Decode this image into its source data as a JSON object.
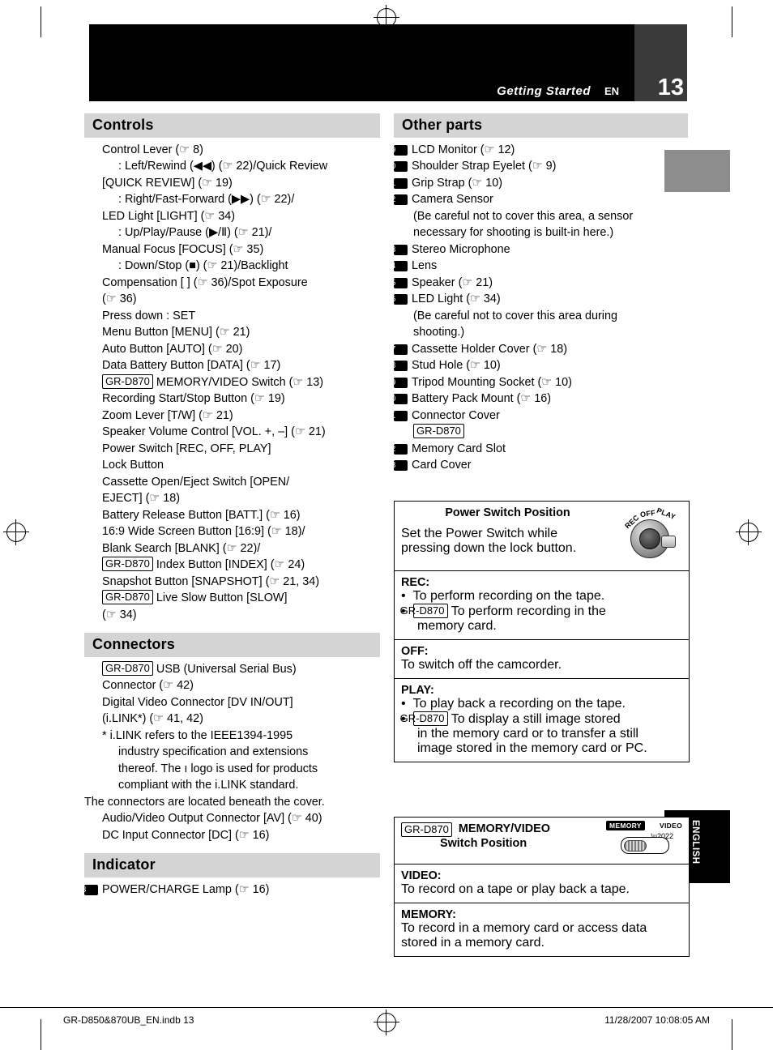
{
  "header": {
    "title": "Getting Started",
    "en": "EN",
    "page": "13"
  },
  "side_tab": {
    "label": "ENGLISH"
  },
  "footer": {
    "left": "GR-D850&870UB_EN.indb   13",
    "right": "11/28/2007   10:08:05 AM"
  },
  "left_column": {
    "controls": {
      "heading": "Controls",
      "lines": [
        {
          "indent": 1,
          "text": "Control Lever (☞ 8)"
        },
        {
          "indent": 2,
          "text": ": Left/Rewind (◀◀) (☞ 22)/Quick Review"
        },
        {
          "indent": 1,
          "text": "[QUICK REVIEW] (☞ 19)"
        },
        {
          "indent": 2,
          "text": ": Right/Fast-Forward (▶▶) (☞ 22)/"
        },
        {
          "indent": 1,
          "text": "LED Light [LIGHT] (☞ 34)"
        },
        {
          "indent": 2,
          "text": ": Up/Play/Pause (▶/Ⅱ) (☞ 21)/"
        },
        {
          "indent": 1,
          "text": "Manual Focus [FOCUS] (☞ 35)"
        },
        {
          "indent": 2,
          "text": ": Down/Stop (■) (☞ 21)/Backlight"
        },
        {
          "indent": 1,
          "text": "Compensation [    ] (☞ 36)/Spot Exposure"
        },
        {
          "indent": 1,
          "text": "(☞ 36)"
        },
        {
          "indent": 1,
          "text": "Press down : SET"
        },
        {
          "indent": 1,
          "text": "Menu Button [MENU] (☞ 21)"
        },
        {
          "indent": 1,
          "text": "Auto Button [AUTO] (☞ 20)"
        },
        {
          "indent": 1,
          "text": "Data Battery Button [DATA] (☞ 17)"
        },
        {
          "indent": 1,
          "badge": "GR-D870",
          "text": " MEMORY/VIDEO Switch (☞ 13)"
        },
        {
          "indent": 1,
          "text": "Recording Start/Stop Button (☞ 19)"
        },
        {
          "indent": 1,
          "text": "Zoom Lever [T/W] (☞ 21)"
        },
        {
          "indent": 1,
          "text": "Speaker Volume Control [VOL. +, –] (☞ 21)"
        },
        {
          "indent": 1,
          "text": "Power Switch [REC, OFF, PLAY]"
        },
        {
          "indent": 1,
          "text": "Lock Button"
        },
        {
          "indent": 1,
          "text": "Cassette Open/Eject Switch [OPEN/"
        },
        {
          "indent": 1,
          "text": "EJECT] (☞ 18)"
        },
        {
          "indent": 1,
          "text": "Battery Release Button [BATT.] (☞ 16)"
        },
        {
          "indent": 1,
          "text": "16:9 Wide Screen Button [16:9] (☞ 18)/"
        },
        {
          "indent": 1,
          "text": "Blank Search [BLANK] (☞ 22)/"
        },
        {
          "indent": 1,
          "badge": "GR-D870",
          "text": " Index Button [INDEX] (☞ 24)"
        },
        {
          "indent": 1,
          "text": "Snapshot Button [SNAPSHOT] (☞ 21, 34)"
        },
        {
          "indent": 1,
          "badge": "GR-D870",
          "text": " Live Slow Button [SLOW]"
        },
        {
          "indent": 1,
          "text": "(☞ 34)"
        }
      ]
    },
    "connectors": {
      "heading": "Connectors",
      "lines": [
        {
          "indent": 1,
          "badge": "GR-D870",
          "text": " USB (Universal Serial Bus)"
        },
        {
          "indent": 1,
          "text": "Connector (☞ 42)"
        },
        {
          "indent": 1,
          "text": "Digital Video Connector [DV IN/OUT]"
        },
        {
          "indent": 1,
          "text": "(i.LINK*) (☞ 41, 42)"
        },
        {
          "indent": 1,
          "text": "* i.LINK refers to the IEEE1394-1995"
        },
        {
          "indent": 2,
          "text": "industry specification and extensions"
        },
        {
          "indent": 2,
          "text": "thereof. The ı logo is used for products"
        },
        {
          "indent": 2,
          "text": "compliant with the i.LINK standard."
        },
        {
          "indent": 0,
          "text": "The connectors are located beneath the cover."
        },
        {
          "indent": 1,
          "text": "Audio/Video Output Connector [AV] (☞ 40)"
        },
        {
          "indent": 1,
          "text": "DC Input Connector [DC] (☞ 16)"
        }
      ]
    },
    "indicator": {
      "heading": "Indicator",
      "items": [
        {
          "num": "18",
          "text": "POWER/CHARGE Lamp (☞ 16)"
        }
      ]
    }
  },
  "right_column": {
    "other_parts": {
      "heading": "Other parts",
      "items": [
        {
          "num": "19",
          "text": "LCD Monitor (☞ 12)"
        },
        {
          "num": "20",
          "text": "Shoulder Strap Eyelet (☞ 9)"
        },
        {
          "num": "21",
          "text": "Grip Strap (☞ 10)"
        },
        {
          "num": "22",
          "text": "Camera Sensor"
        },
        {
          "sub": "(Be careful not to cover this area, a sensor"
        },
        {
          "sub": "necessary for shooting is built-in here.)"
        },
        {
          "num": "23",
          "text": "Stereo Microphone"
        },
        {
          "num": "24",
          "text": "Lens"
        },
        {
          "num": "25",
          "text": "Speaker (☞ 21)"
        },
        {
          "num": "26",
          "text": "LED Light (☞ 34)"
        },
        {
          "sub": "(Be careful not to cover this area during"
        },
        {
          "sub": "shooting.)"
        },
        {
          "num": "27",
          "text": "Cassette Holder Cover (☞ 18)"
        },
        {
          "num": "28",
          "text": "Stud Hole (☞ 10)"
        },
        {
          "num": "29",
          "text": "Tripod Mounting Socket (☞ 10)"
        },
        {
          "num": "30",
          "text": "Battery Pack Mount (☞ 16)"
        },
        {
          "num": "31",
          "text": "Connector Cover"
        },
        {
          "badge": "GR-D870"
        },
        {
          "num": "32",
          "text": "Memory Card Slot"
        },
        {
          "num": "33",
          "text": "Card Cover"
        }
      ]
    },
    "power_switch_box": {
      "title": "Power Switch Position",
      "desc_line1": "Set the Power Switch while",
      "desc_line2": "pressing down the lock button.",
      "dial_labels": {
        "rec": "REC",
        "off": "OFF",
        "play": "PLAY"
      },
      "sections": [
        {
          "label": "REC:",
          "bullets": [
            {
              "text": "To perform recording on the tape."
            },
            {
              "badge": "GR-D870",
              "text": " To perform recording in the",
              "cont": "memory card."
            }
          ]
        },
        {
          "label": "OFF:",
          "plain": "To switch off the camcorder."
        },
        {
          "label": "PLAY:",
          "bullets": [
            {
              "text": "To play back a recording on the tape."
            },
            {
              "badge": "GR-D870",
              "text": " To display a still image stored",
              "cont": "in the memory card or to transfer a still",
              "cont2": "image stored in the memory card or PC."
            }
          ]
        }
      ]
    },
    "memory_video_box": {
      "badge": "GR-D870",
      "title_line1": "MEMORY/VIDEO",
      "title_line2": "Switch Position",
      "switch_labels": {
        "memory": "MEMORY",
        "video": "VIDEO"
      },
      "sections": [
        {
          "label": "VIDEO:",
          "text": "To record on a tape or play back a tape."
        },
        {
          "label": "MEMORY:",
          "text": "To record in a memory card or access data",
          "text2": "stored in a memory card."
        }
      ]
    }
  }
}
